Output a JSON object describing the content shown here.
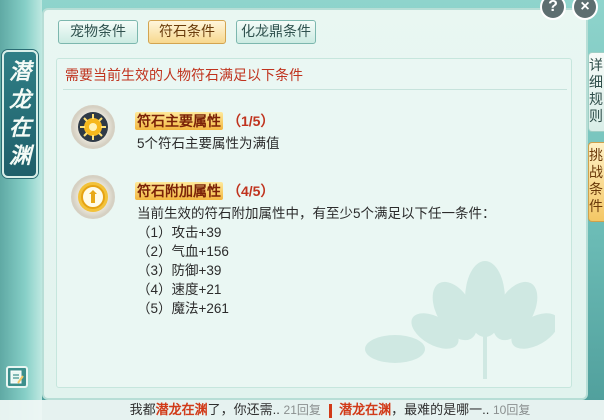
{
  "left_banner": {
    "chars": [
      "潜",
      "龙",
      "在",
      "渊"
    ]
  },
  "tabs": [
    {
      "label": "宠物条件",
      "active": false
    },
    {
      "label": "符石条件",
      "active": true
    },
    {
      "label": "化龙鼎条件",
      "active": false
    }
  ],
  "headline": "需要当前生效的人物符石满足以下条件",
  "conditions": [
    {
      "icon": "sun-rune-icon",
      "name": "符石主要属性",
      "count": "（1/5）",
      "lines": [
        "5个符石主要属性为满值"
      ]
    },
    {
      "icon": "shield-rune-icon",
      "name": "符石附加属性",
      "count": "（4/5）",
      "lines": [
        "当前生效的符石附加属性中，有至少5个满足以下任一条件：",
        "（1）攻击+39",
        "（2）气血+156",
        "（3）防御+39",
        "（4）速度+21",
        "（5）魔法+261"
      ]
    }
  ],
  "side_tabs": [
    {
      "label": "详细规则",
      "highlight": false
    },
    {
      "label": "挑战条件",
      "highlight": true
    }
  ],
  "top_buttons": {
    "help": "?",
    "close": "×"
  },
  "chat": {
    "left_prefix": "我都",
    "left_highlight": "潜龙在渊",
    "left_suffix": "了，你还需..",
    "left_replies": "21回复",
    "right_highlight": "潜龙在渊",
    "right_suffix": "，最难的是哪一..",
    "right_replies": "10回复"
  },
  "colors": {
    "accent_red": "#c0331e",
    "tab_active": "#f7d88e",
    "panel_bg": "#e9f7f2"
  }
}
